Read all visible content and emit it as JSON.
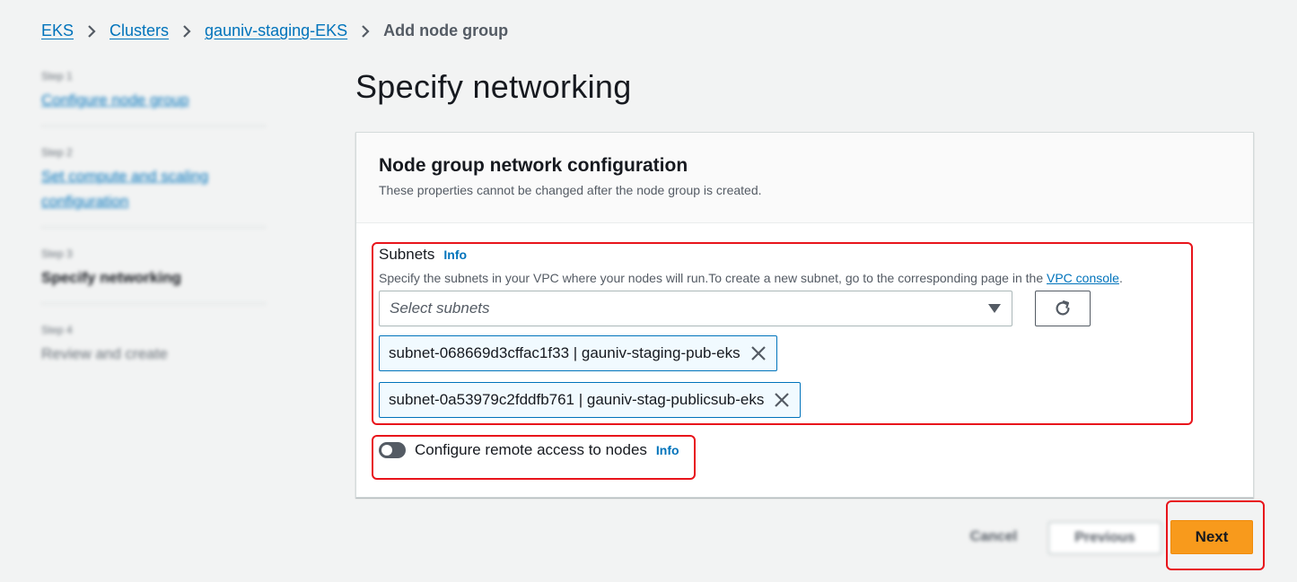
{
  "breadcrumb": {
    "items": [
      "EKS",
      "Clusters",
      "gauniv-staging-EKS"
    ],
    "current": "Add node group"
  },
  "steps": [
    {
      "num": "Step 1",
      "title": "Configure node group"
    },
    {
      "num": "Step 2",
      "title_line1": "Set compute and scaling",
      "title_line2": "configuration"
    },
    {
      "num": "Step 3",
      "title": "Specify networking"
    },
    {
      "num": "Step 4",
      "title": "Review and create"
    }
  ],
  "page_title": "Specify networking",
  "card": {
    "title": "Node group network configuration",
    "description": "These properties cannot be changed after the node group is created."
  },
  "subnets": {
    "label": "Subnets",
    "info": "Info",
    "description": "Specify the subnets in your VPC where your nodes will run.To create a new subnet, go to the corresponding page in the ",
    "description_link": "VPC console",
    "description_end": ".",
    "placeholder": "Select subnets",
    "selected": [
      "subnet-068669d3cffac1f33 | gauniv-staging-pub-eks",
      "subnet-0a53979c2fddfb761 | gauniv-stag-publicsub-eks"
    ]
  },
  "remote_access": {
    "label": "Configure remote access to nodes",
    "info": "Info",
    "enabled": false
  },
  "footer": {
    "cancel": "Cancel",
    "previous": "Previous",
    "next": "Next"
  },
  "colors": {
    "link": "#0073bb",
    "primary_button": "#f89a1c",
    "highlight": "#e8141b"
  }
}
